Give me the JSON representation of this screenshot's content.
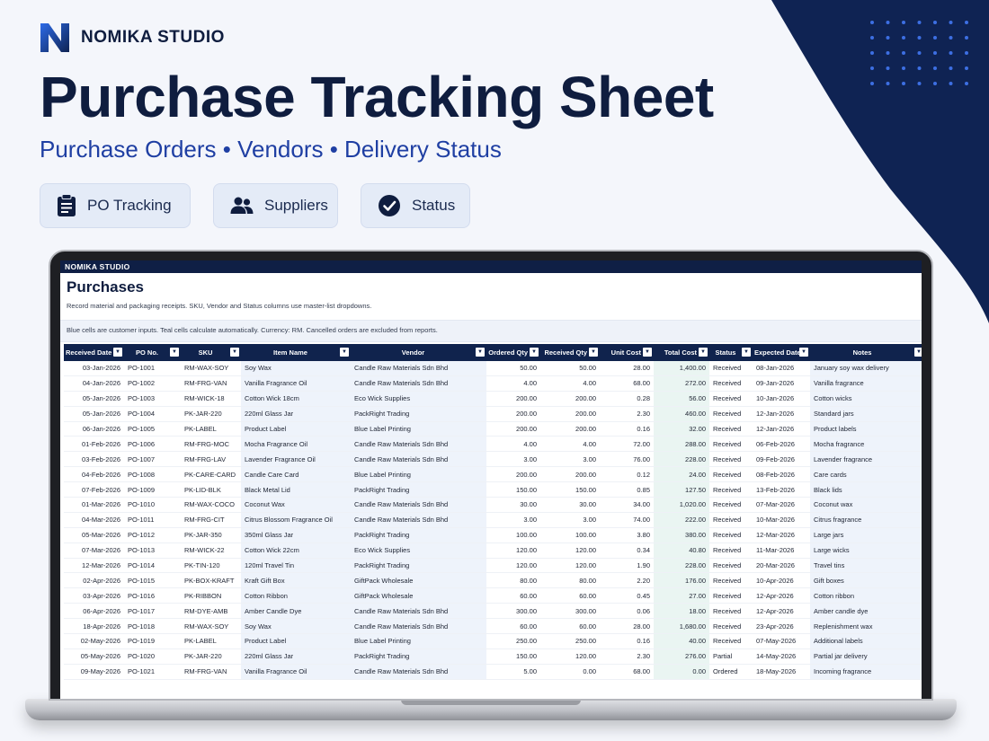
{
  "brand": {
    "name": "NOMIKA STUDIO",
    "logo_icon": "n-logo-icon"
  },
  "hero": {
    "title": "Purchase Tracking Sheet",
    "subtitle": "Purchase Orders • Vendors • Delivery Status"
  },
  "features": [
    {
      "label": "PO Tracking",
      "icon": "clipboard-icon"
    },
    {
      "label": "Suppliers",
      "icon": "users-icon"
    },
    {
      "label": "Status",
      "icon": "check-circle-icon"
    }
  ],
  "colors": {
    "navy": "#0f1d3f",
    "accent_blue": "#1f3fa3",
    "header": "#10234d",
    "teal_cell": "#eaf5f2",
    "blue_cell": "#eef3fb"
  },
  "sheet": {
    "topbar": "NOMIKA STUDIO",
    "title": "Purchases",
    "description": "Record material and packaging receipts. SKU, Vendor and Status columns use master-list dropdowns.",
    "note": "Blue cells are customer inputs. Teal cells calculate automatically. Currency: RM. Cancelled orders are excluded from reports.",
    "columns": [
      "Received Date",
      "PO No.",
      "SKU",
      "Item Name",
      "Vendor",
      "Ordered Qty",
      "Received Qty",
      "Unit Cost",
      "Total Cost",
      "Status",
      "Expected Date",
      "Notes"
    ],
    "rows": [
      [
        "03-Jan-2026",
        "PO-1001",
        "RM-WAX-SOY",
        "Soy Wax",
        "Candle Raw Materials Sdn Bhd",
        "50.00",
        "50.00",
        "28.00",
        "1,400.00",
        "Received",
        "08-Jan-2026",
        "January soy wax delivery"
      ],
      [
        "04-Jan-2026",
        "PO-1002",
        "RM-FRG-VAN",
        "Vanilla Fragrance Oil",
        "Candle Raw Materials Sdn Bhd",
        "4.00",
        "4.00",
        "68.00",
        "272.00",
        "Received",
        "09-Jan-2026",
        "Vanilla fragrance"
      ],
      [
        "05-Jan-2026",
        "PO-1003",
        "RM-WICK-18",
        "Cotton Wick 18cm",
        "Eco Wick Supplies",
        "200.00",
        "200.00",
        "0.28",
        "56.00",
        "Received",
        "10-Jan-2026",
        "Cotton wicks"
      ],
      [
        "05-Jan-2026",
        "PO-1004",
        "PK-JAR-220",
        "220ml Glass Jar",
        "PackRight Trading",
        "200.00",
        "200.00",
        "2.30",
        "460.00",
        "Received",
        "12-Jan-2026",
        "Standard jars"
      ],
      [
        "06-Jan-2026",
        "PO-1005",
        "PK-LABEL",
        "Product Label",
        "Blue Label Printing",
        "200.00",
        "200.00",
        "0.16",
        "32.00",
        "Received",
        "12-Jan-2026",
        "Product labels"
      ],
      [
        "01-Feb-2026",
        "PO-1006",
        "RM-FRG-MOC",
        "Mocha Fragrance Oil",
        "Candle Raw Materials Sdn Bhd",
        "4.00",
        "4.00",
        "72.00",
        "288.00",
        "Received",
        "06-Feb-2026",
        "Mocha fragrance"
      ],
      [
        "03-Feb-2026",
        "PO-1007",
        "RM-FRG-LAV",
        "Lavender Fragrance Oil",
        "Candle Raw Materials Sdn Bhd",
        "3.00",
        "3.00",
        "76.00",
        "228.00",
        "Received",
        "09-Feb-2026",
        "Lavender fragrance"
      ],
      [
        "04-Feb-2026",
        "PO-1008",
        "PK-CARE-CARD",
        "Candle Care Card",
        "Blue Label Printing",
        "200.00",
        "200.00",
        "0.12",
        "24.00",
        "Received",
        "08-Feb-2026",
        "Care cards"
      ],
      [
        "07-Feb-2026",
        "PO-1009",
        "PK-LID-BLK",
        "Black Metal Lid",
        "PackRight Trading",
        "150.00",
        "150.00",
        "0.85",
        "127.50",
        "Received",
        "13-Feb-2026",
        "Black lids"
      ],
      [
        "01-Mar-2026",
        "PO-1010",
        "RM-WAX-COCO",
        "Coconut Wax",
        "Candle Raw Materials Sdn Bhd",
        "30.00",
        "30.00",
        "34.00",
        "1,020.00",
        "Received",
        "07-Mar-2026",
        "Coconut wax"
      ],
      [
        "04-Mar-2026",
        "PO-1011",
        "RM-FRG-CIT",
        "Citrus Blossom Fragrance Oil",
        "Candle Raw Materials Sdn Bhd",
        "3.00",
        "3.00",
        "74.00",
        "222.00",
        "Received",
        "10-Mar-2026",
        "Citrus fragrance"
      ],
      [
        "05-Mar-2026",
        "PO-1012",
        "PK-JAR-350",
        "350ml Glass Jar",
        "PackRight Trading",
        "100.00",
        "100.00",
        "3.80",
        "380.00",
        "Received",
        "12-Mar-2026",
        "Large jars"
      ],
      [
        "07-Mar-2026",
        "PO-1013",
        "RM-WICK-22",
        "Cotton Wick 22cm",
        "Eco Wick Supplies",
        "120.00",
        "120.00",
        "0.34",
        "40.80",
        "Received",
        "11-Mar-2026",
        "Large wicks"
      ],
      [
        "12-Mar-2026",
        "PO-1014",
        "PK-TIN-120",
        "120ml Travel Tin",
        "PackRight Trading",
        "120.00",
        "120.00",
        "1.90",
        "228.00",
        "Received",
        "20-Mar-2026",
        "Travel tins"
      ],
      [
        "02-Apr-2026",
        "PO-1015",
        "PK-BOX-KRAFT",
        "Kraft Gift Box",
        "GiftPack Wholesale",
        "80.00",
        "80.00",
        "2.20",
        "176.00",
        "Received",
        "10-Apr-2026",
        "Gift boxes"
      ],
      [
        "03-Apr-2026",
        "PO-1016",
        "PK-RIBBON",
        "Cotton Ribbon",
        "GiftPack Wholesale",
        "60.00",
        "60.00",
        "0.45",
        "27.00",
        "Received",
        "12-Apr-2026",
        "Cotton ribbon"
      ],
      [
        "06-Apr-2026",
        "PO-1017",
        "RM-DYE-AMB",
        "Amber Candle Dye",
        "Candle Raw Materials Sdn Bhd",
        "300.00",
        "300.00",
        "0.06",
        "18.00",
        "Received",
        "12-Apr-2026",
        "Amber candle dye"
      ],
      [
        "18-Apr-2026",
        "PO-1018",
        "RM-WAX-SOY",
        "Soy Wax",
        "Candle Raw Materials Sdn Bhd",
        "60.00",
        "60.00",
        "28.00",
        "1,680.00",
        "Received",
        "23-Apr-2026",
        "Replenishment wax"
      ],
      [
        "02-May-2026",
        "PO-1019",
        "PK-LABEL",
        "Product Label",
        "Blue Label Printing",
        "250.00",
        "250.00",
        "0.16",
        "40.00",
        "Received",
        "07-May-2026",
        "Additional labels"
      ],
      [
        "05-May-2026",
        "PO-1020",
        "PK-JAR-220",
        "220ml Glass Jar",
        "PackRight Trading",
        "150.00",
        "120.00",
        "2.30",
        "276.00",
        "Partial",
        "14-May-2026",
        "Partial jar delivery"
      ],
      [
        "09-May-2026",
        "PO-1021",
        "RM-FRG-VAN",
        "Vanilla Fragrance Oil",
        "Candle Raw Materials Sdn Bhd",
        "5.00",
        "0.00",
        "68.00",
        "0.00",
        "Ordered",
        "18-May-2026",
        "Incoming fragrance"
      ]
    ]
  }
}
